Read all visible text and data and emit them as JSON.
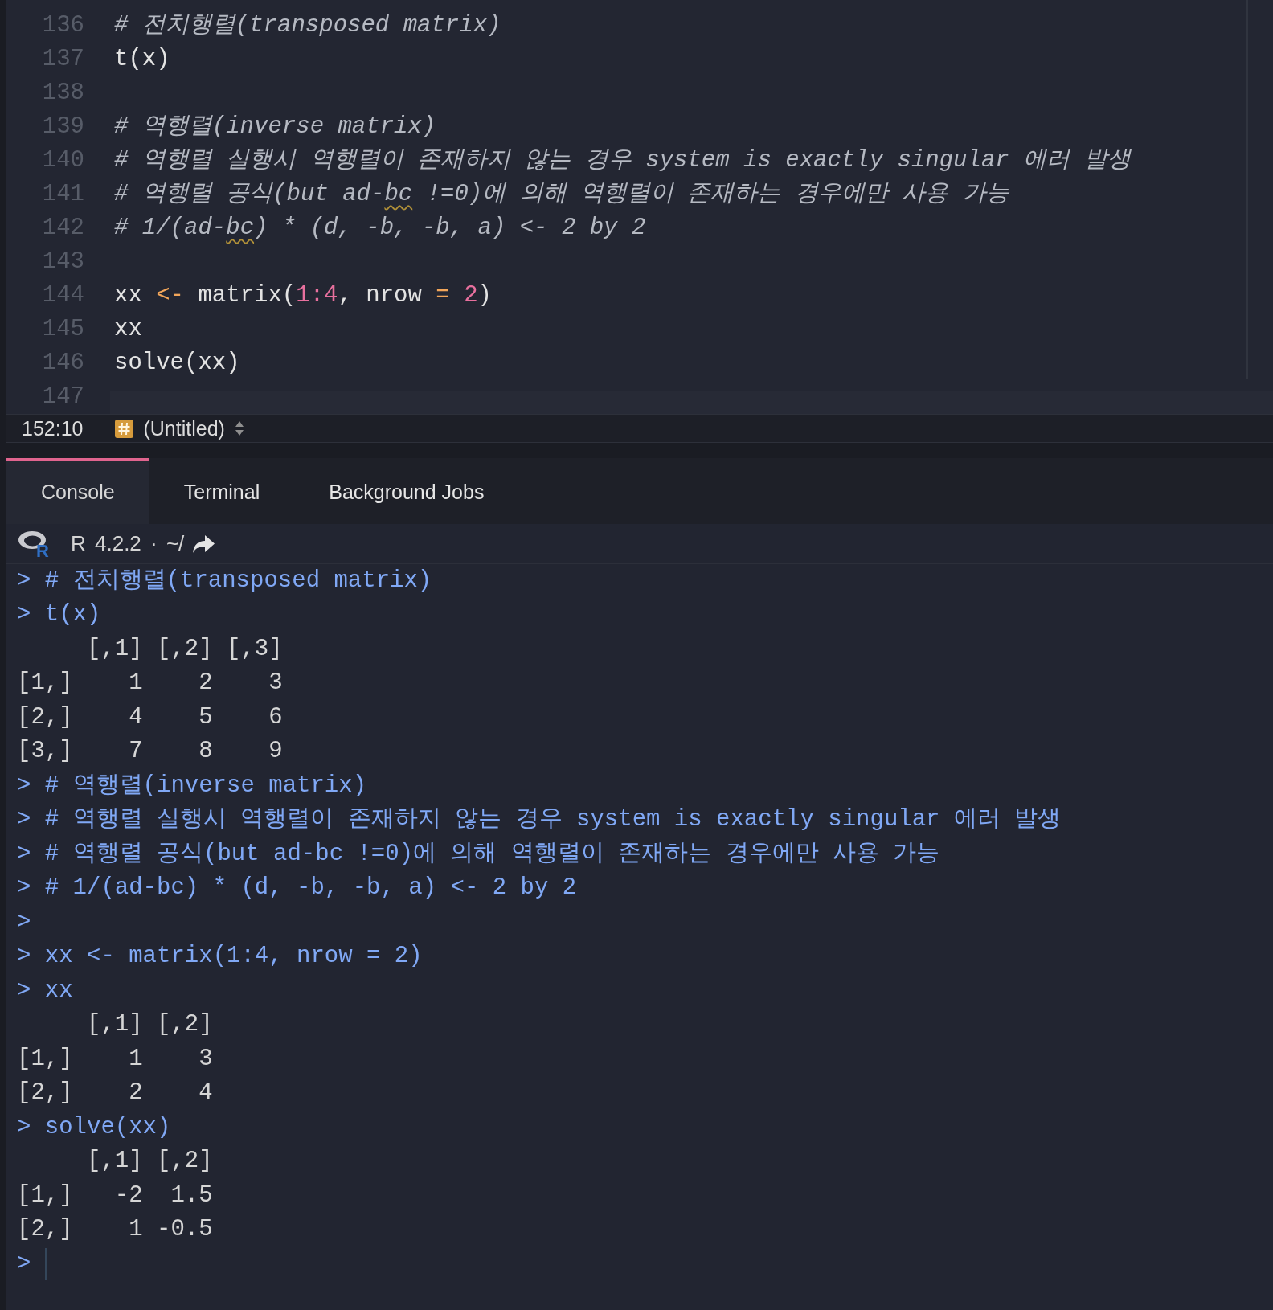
{
  "editor": {
    "lines": [
      {
        "number": "136",
        "tokens": [
          {
            "text": "# 전치행렬(transposed matrix)",
            "kind": "comment"
          }
        ]
      },
      {
        "number": "137",
        "tokens": [
          {
            "text": "t(x)",
            "kind": "plain"
          }
        ]
      },
      {
        "number": "138"
      },
      {
        "number": "139",
        "tokens": [
          {
            "text": "# 역행렬(inverse matrix)",
            "kind": "comment"
          }
        ]
      },
      {
        "number": "140",
        "tokens": [
          {
            "text": "# 역행렬 실행시 역행렬이 존재하지 않는 경우 system is exactly singular 에러 발생",
            "kind": "comment"
          }
        ]
      },
      {
        "number": "141",
        "tokens": [
          {
            "text": "# 역행렬 공식(but ad-",
            "kind": "comment"
          },
          {
            "text": "bc",
            "kind": "misspelled"
          },
          {
            "text": " !=0)에 의해 역행렬이 존재하는 경우에만 사용 가능",
            "kind": "comment"
          }
        ]
      },
      {
        "number": "142",
        "tokens": [
          {
            "text": "# 1/(ad-",
            "kind": "comment"
          },
          {
            "text": "bc",
            "kind": "misspelled"
          },
          {
            "text": ") * (d, -b, -b, a) <- 2 by 2",
            "kind": "comment"
          }
        ]
      },
      {
        "number": "143"
      },
      {
        "number": "144",
        "tokens": [
          {
            "text": "xx ",
            "kind": "plain"
          },
          {
            "text": "<-",
            "kind": "operator"
          },
          {
            "text": " matrix(",
            "kind": "plain"
          },
          {
            "text": "1:4",
            "kind": "number"
          },
          {
            "text": ", nrow ",
            "kind": "plain"
          },
          {
            "text": "= ",
            "kind": "operator"
          },
          {
            "text": "2",
            "kind": "number"
          },
          {
            "text": ")",
            "kind": "plain"
          }
        ]
      },
      {
        "number": "145",
        "tokens": [
          {
            "text": "xx",
            "kind": "plain"
          }
        ]
      },
      {
        "number": "146",
        "tokens": [
          {
            "text": "solve(xx)",
            "kind": "plain"
          }
        ]
      },
      {
        "number": "147"
      }
    ]
  },
  "status_bar": {
    "position": "152:10",
    "document": "(Untitled)"
  },
  "tabs": [
    {
      "label": "Console",
      "selected": true
    },
    {
      "label": "Terminal",
      "selected": false
    },
    {
      "label": "Background Jobs",
      "selected": false
    }
  ],
  "console": {
    "header": {
      "logo_letter": "R",
      "version": "R 4.2.2 · ~/"
    },
    "lines": [
      {
        "kind": "input",
        "prompt": ">",
        "text": "# 전치행렬(transposed matrix)"
      },
      {
        "kind": "input",
        "prompt": ">",
        "text": "t(x)"
      },
      {
        "kind": "matrix",
        "columns": [
          "[,1]",
          "[,2]",
          "[,3]"
        ],
        "rows": [
          {
            "label": "[1,]",
            "values": [
              "1",
              "2",
              "3"
            ]
          },
          {
            "label": "[2,]",
            "values": [
              "4",
              "5",
              "6"
            ]
          },
          {
            "label": "[3,]",
            "values": [
              "7",
              "8",
              "9"
            ]
          }
        ]
      },
      {
        "kind": "input",
        "prompt": ">",
        "text": "# 역행렬(inverse matrix)"
      },
      {
        "kind": "input",
        "prompt": ">",
        "text": "# 역행렬 실행시 역행렬이 존재하지 않는 경우 system is exactly singular 에러 발생"
      },
      {
        "kind": "input",
        "prompt": ">",
        "text": "# 역행렬 공식(but ad-bc !=0)에 의해 역행렬이 존재하는 경우에만 사용 가능"
      },
      {
        "kind": "input",
        "prompt": ">",
        "text": "# 1/(ad-bc) * (d, -b, -b, a) <- 2 by 2"
      },
      {
        "kind": "input",
        "prompt": ">"
      },
      {
        "kind": "input",
        "prompt": ">",
        "text": "xx <- matrix(1:4, nrow = 2)"
      },
      {
        "kind": "input",
        "prompt": ">",
        "text": "xx"
      },
      {
        "kind": "matrix",
        "columns": [
          "[,1]",
          "[,2]"
        ],
        "rows": [
          {
            "label": "[1,]",
            "values": [
              "1",
              "3"
            ]
          },
          {
            "label": "[2,]",
            "values": [
              "2",
              "4"
            ]
          }
        ]
      },
      {
        "kind": "input",
        "prompt": ">",
        "text": "solve(xx)"
      },
      {
        "kind": "matrix",
        "columns": [
          "[,1]",
          "[,2]"
        ],
        "rows": [
          {
            "label": "[1,]",
            "values": [
              "-2",
              "1.5"
            ]
          },
          {
            "label": "[2,]",
            "values": [
              "1",
              "-0.5"
            ]
          }
        ]
      },
      {
        "kind": "prompt",
        "prompt": ">"
      }
    ]
  }
}
